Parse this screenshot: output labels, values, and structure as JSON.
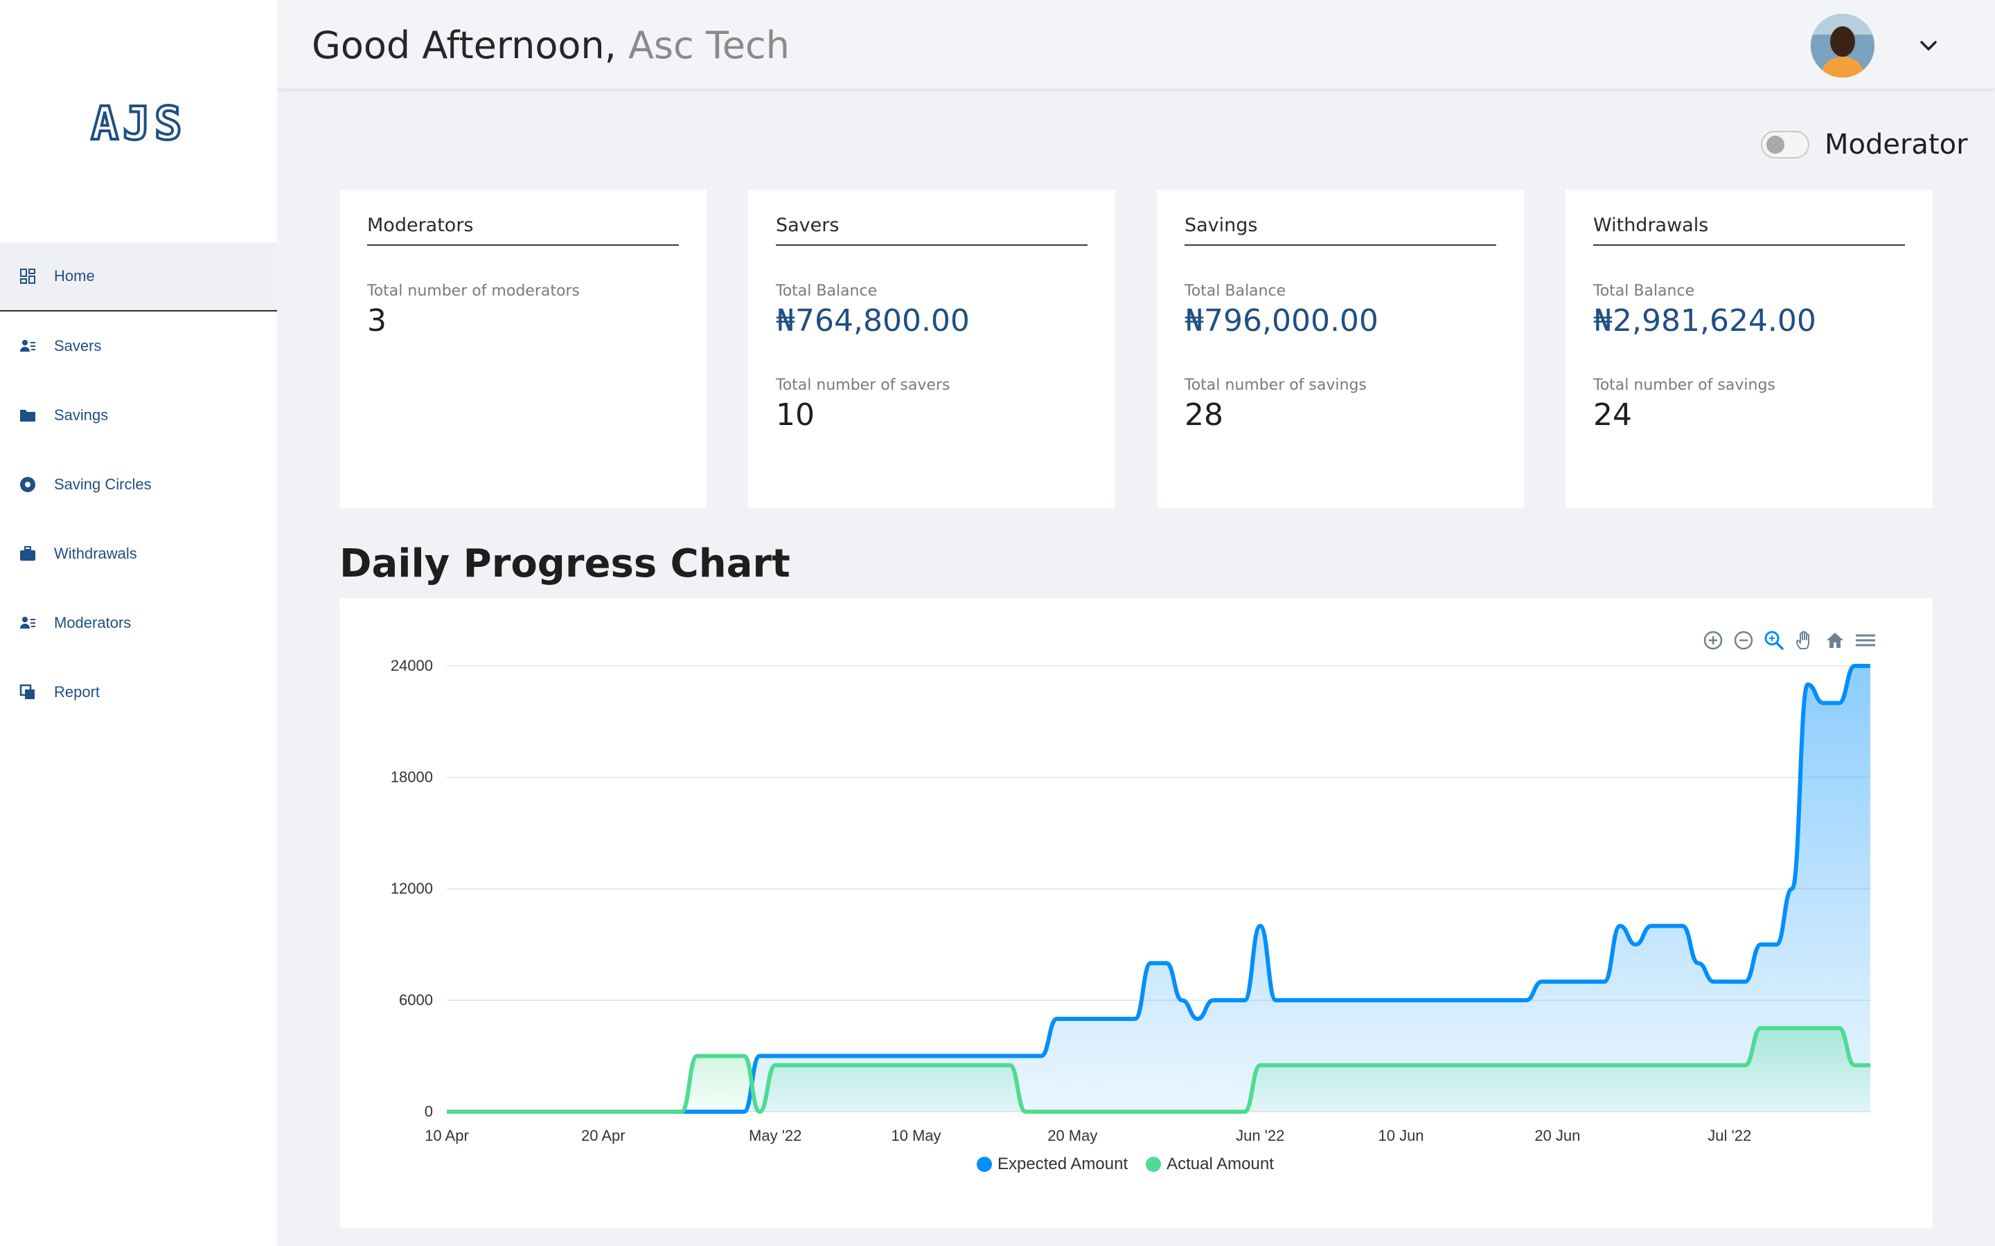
{
  "app": {
    "logo": "AJS"
  },
  "sidebar": {
    "items": [
      {
        "label": "Home",
        "icon": "dashboard-icon",
        "active": true
      },
      {
        "label": "Savers",
        "icon": "users-icon"
      },
      {
        "label": "Savings",
        "icon": "folder-icon"
      },
      {
        "label": "Saving Circles",
        "icon": "circle-icon"
      },
      {
        "label": "Withdrawals",
        "icon": "briefcase-icon"
      },
      {
        "label": "Moderators",
        "icon": "user-list-icon"
      },
      {
        "label": "Report",
        "icon": "copy-icon"
      }
    ]
  },
  "header": {
    "greeting": "Good Afternoon,",
    "user_name": "Asc Tech"
  },
  "toggle": {
    "label": "Moderator",
    "on": false
  },
  "cards": [
    {
      "title": "Moderators",
      "label1": "Total number of moderators",
      "value1": "3"
    },
    {
      "title": "Savers",
      "label1": "Total Balance",
      "value1": "₦764,800.00",
      "label2": "Total number of savers",
      "value2": "10"
    },
    {
      "title": "Savings",
      "label1": "Total Balance",
      "value1": "₦796,000.00",
      "label2": "Total number of savings",
      "value2": "28"
    },
    {
      "title": "Withdrawals",
      "label1": "Total Balance",
      "value1": "₦2,981,624.00",
      "label2": "Total number of savings",
      "value2": "24"
    }
  ],
  "section_title": "Daily Progress Chart",
  "colors": {
    "primary": "#1f4f85",
    "expected": "#008ffb",
    "actual": "#4fdb91"
  },
  "chart_data": {
    "type": "area",
    "title": "",
    "xlabel": "",
    "ylabel": "",
    "ylim": [
      0,
      24000
    ],
    "yticks": [
      "24000",
      "18000",
      "12000",
      "6000",
      "0"
    ],
    "xticks": [
      "10 Apr",
      "20 Apr",
      "May '22",
      "10 May",
      "20 May",
      "Jun '22",
      "10 Jun",
      "20 Jun",
      "Jul '22"
    ],
    "grid": true,
    "legend_position": "bottom",
    "series": [
      {
        "name": "Expected Amount",
        "color": "#008ffb",
        "points": [
          [
            "2022-04-10",
            0
          ],
          [
            "2022-04-29",
            0
          ],
          [
            "2022-04-30",
            3000
          ],
          [
            "2022-05-18",
            3000
          ],
          [
            "2022-05-19",
            5000
          ],
          [
            "2022-05-24",
            5000
          ],
          [
            "2022-05-25",
            8000
          ],
          [
            "2022-05-26",
            8000
          ],
          [
            "2022-05-27",
            6000
          ],
          [
            "2022-05-28",
            5000
          ],
          [
            "2022-05-29",
            6000
          ],
          [
            "2022-05-31",
            6000
          ],
          [
            "2022-06-01",
            10000
          ],
          [
            "2022-06-02",
            6000
          ],
          [
            "2022-06-18",
            6000
          ],
          [
            "2022-06-19",
            7000
          ],
          [
            "2022-06-23",
            7000
          ],
          [
            "2022-06-24",
            10000
          ],
          [
            "2022-06-25",
            9000
          ],
          [
            "2022-06-26",
            10000
          ],
          [
            "2022-06-28",
            10000
          ],
          [
            "2022-06-29",
            8000
          ],
          [
            "2022-06-30",
            7000
          ],
          [
            "2022-07-02",
            7000
          ],
          [
            "2022-07-03",
            9000
          ],
          [
            "2022-07-04",
            9000
          ],
          [
            "2022-07-05",
            12000
          ],
          [
            "2022-07-06",
            23000
          ],
          [
            "2022-07-07",
            22000
          ],
          [
            "2022-07-08",
            22000
          ],
          [
            "2022-07-09",
            24000
          ],
          [
            "2022-07-10",
            24000
          ]
        ]
      },
      {
        "name": "Actual Amount",
        "color": "#4fdb91",
        "points": [
          [
            "2022-04-10",
            0
          ],
          [
            "2022-04-25",
            0
          ],
          [
            "2022-04-26",
            3000
          ],
          [
            "2022-04-29",
            3000
          ],
          [
            "2022-04-30",
            0
          ],
          [
            "2022-05-01",
            2500
          ],
          [
            "2022-05-16",
            2500
          ],
          [
            "2022-05-17",
            0
          ],
          [
            "2022-05-31",
            0
          ],
          [
            "2022-06-01",
            2500
          ],
          [
            "2022-07-02",
            2500
          ],
          [
            "2022-07-03",
            4500
          ],
          [
            "2022-07-08",
            4500
          ],
          [
            "2022-07-09",
            2500
          ],
          [
            "2022-07-10",
            2500
          ]
        ]
      }
    ]
  }
}
